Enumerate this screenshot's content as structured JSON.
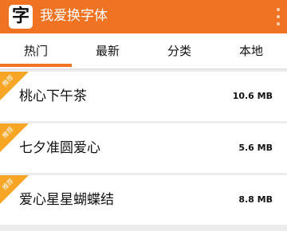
{
  "app": {
    "logo_char": "字",
    "title": "我爱换字体",
    "accent_color": "#f07324",
    "ribbon_color": "#f6a524",
    "menu_icon": "overflow-menu-icon"
  },
  "tabs": [
    {
      "label": "热门",
      "active": true
    },
    {
      "label": "最新",
      "active": false
    },
    {
      "label": "分类",
      "active": false
    },
    {
      "label": "本地",
      "active": false
    }
  ],
  "fonts": [
    {
      "badge": "推荐",
      "name": "桃心下午茶",
      "size": "10.6 MB"
    },
    {
      "badge": "推荐",
      "name": "七夕准圆爱心",
      "size": "5.6 MB"
    },
    {
      "badge": "推荐",
      "name": "爱心星星蝴蝶结",
      "size": "8.8 MB"
    }
  ]
}
